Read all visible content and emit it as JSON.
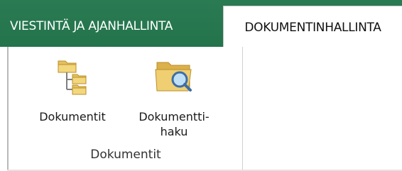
{
  "tabs": {
    "inactive_label": "VIESTINTÄ JA AJANHALLINTA",
    "active_label": "DOKUMENTINHALLINTA"
  },
  "ribbon": {
    "group_label": "Dokumentit",
    "buttons": [
      {
        "label_line1": "Dokumentit",
        "label_line2": "",
        "icon": "folder-tree-icon"
      },
      {
        "label_line1": "Dokumentti-",
        "label_line2": "haku",
        "icon": "folder-search-icon"
      }
    ]
  },
  "colors": {
    "tab_bar": "#23744b",
    "folder": "#e6c15b"
  }
}
